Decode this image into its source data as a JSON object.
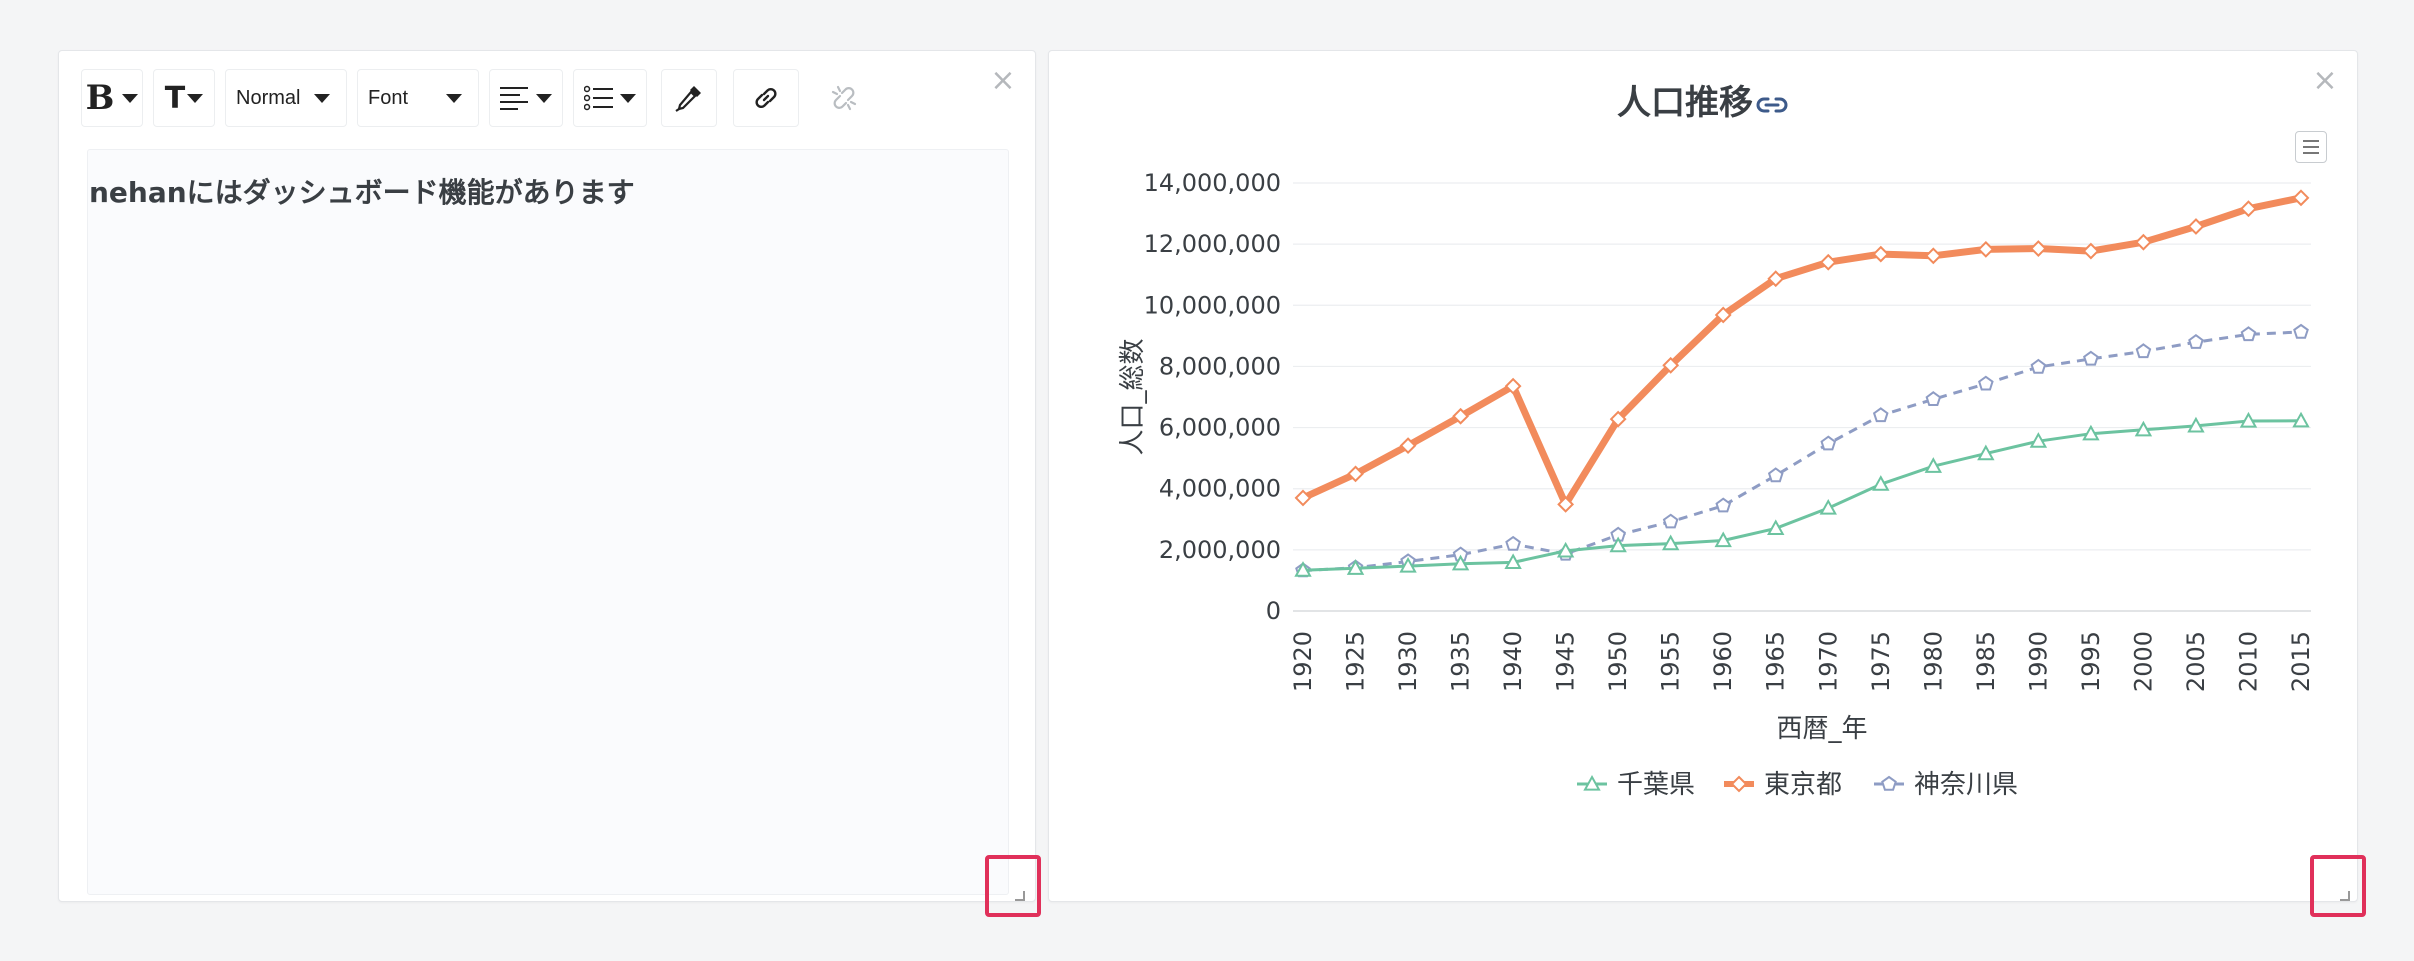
{
  "editor": {
    "toolbar": {
      "bold_label": "B",
      "text_size_label": "T",
      "size_select": "Normal",
      "font_select": "Font"
    },
    "content": "nehanにはダッシュボード機能があります"
  },
  "chart_panel": {
    "title": "人口推移"
  },
  "chart_data": {
    "type": "line",
    "title": "人口推移",
    "xlabel": "西暦_年",
    "ylabel": "人口_総数",
    "x": [
      "1920",
      "1925",
      "1930",
      "1935",
      "1940",
      "1945",
      "1950",
      "1955",
      "1960",
      "1965",
      "1970",
      "1975",
      "1980",
      "1985",
      "1990",
      "1995",
      "2000",
      "2005",
      "2010",
      "2015"
    ],
    "y_ticks": [
      "0",
      "2,000,000",
      "4,000,000",
      "6,000,000",
      "8,000,000",
      "10,000,000",
      "12,000,000",
      "14,000,000"
    ],
    "ylim": [
      0,
      14000000
    ],
    "grid": true,
    "legend_position": "bottom",
    "series": [
      {
        "name": "千葉県",
        "color": "#6cc3a0",
        "marker": "triangle",
        "values": [
          1336000,
          1399000,
          1470000,
          1546000,
          1589000,
          1966000,
          2139000,
          2205000,
          2306000,
          2702000,
          3367000,
          4149000,
          4735000,
          5148000,
          5555000,
          5798000,
          5926000,
          6056000,
          6216000,
          6223000
        ]
      },
      {
        "name": "東京都",
        "color": "#f28b5c",
        "marker": "diamond",
        "values": [
          3699000,
          4485000,
          5409000,
          6370000,
          7355000,
          3488000,
          6278000,
          8037000,
          9684000,
          10869000,
          11408000,
          11674000,
          11618000,
          11829000,
          11856000,
          11774000,
          12064000,
          12577000,
          13159000,
          13515000
        ]
      },
      {
        "name": "神奈川県",
        "color": "#8e9cc4",
        "marker": "pentagon",
        "values": [
          1323000,
          1417000,
          1620000,
          1840000,
          2189000,
          1866000,
          2488000,
          2919000,
          3443000,
          4431000,
          5472000,
          6398000,
          6924000,
          7432000,
          7980000,
          8246000,
          8490000,
          8792000,
          9048000,
          9126000
        ]
      }
    ]
  }
}
